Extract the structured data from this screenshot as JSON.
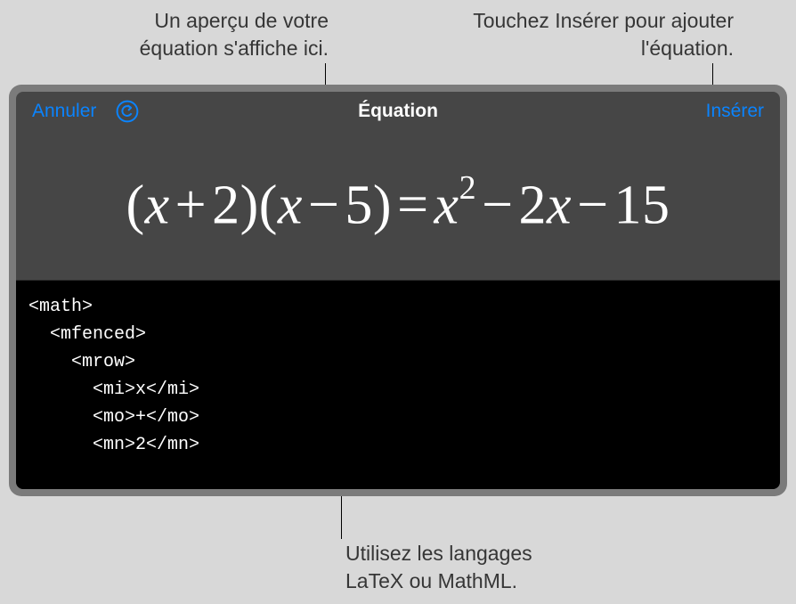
{
  "callouts": {
    "top_left": "Un aperçu de votre équation s'affiche ici.",
    "top_right": "Touchez Insérer pour ajouter l'équation.",
    "bottom": "Utilisez les langages LaTeX ou MathML."
  },
  "navbar": {
    "cancel": "Annuler",
    "title": "Équation",
    "insert": "Insérer",
    "undo_icon": "undo-icon"
  },
  "equation": {
    "lhs_a_var": "x",
    "lhs_a_op": "+",
    "lhs_a_num": "2",
    "lhs_b_var": "x",
    "lhs_b_op": "−",
    "lhs_b_num": "5",
    "eq": "=",
    "rhs_var1": "x",
    "rhs_sup": "2",
    "rhs_op1": "−",
    "rhs_num1": "2",
    "rhs_var2": "x",
    "rhs_op2": "−",
    "rhs_num2": "15"
  },
  "code_lines": {
    "l0": "<math>",
    "l1": "  <mfenced>",
    "l2": "    <mrow>",
    "l3": "      <mi>x</mi>",
    "l4": "      <mo>+</mo>",
    "l5": "      <mn>2</mn>"
  }
}
